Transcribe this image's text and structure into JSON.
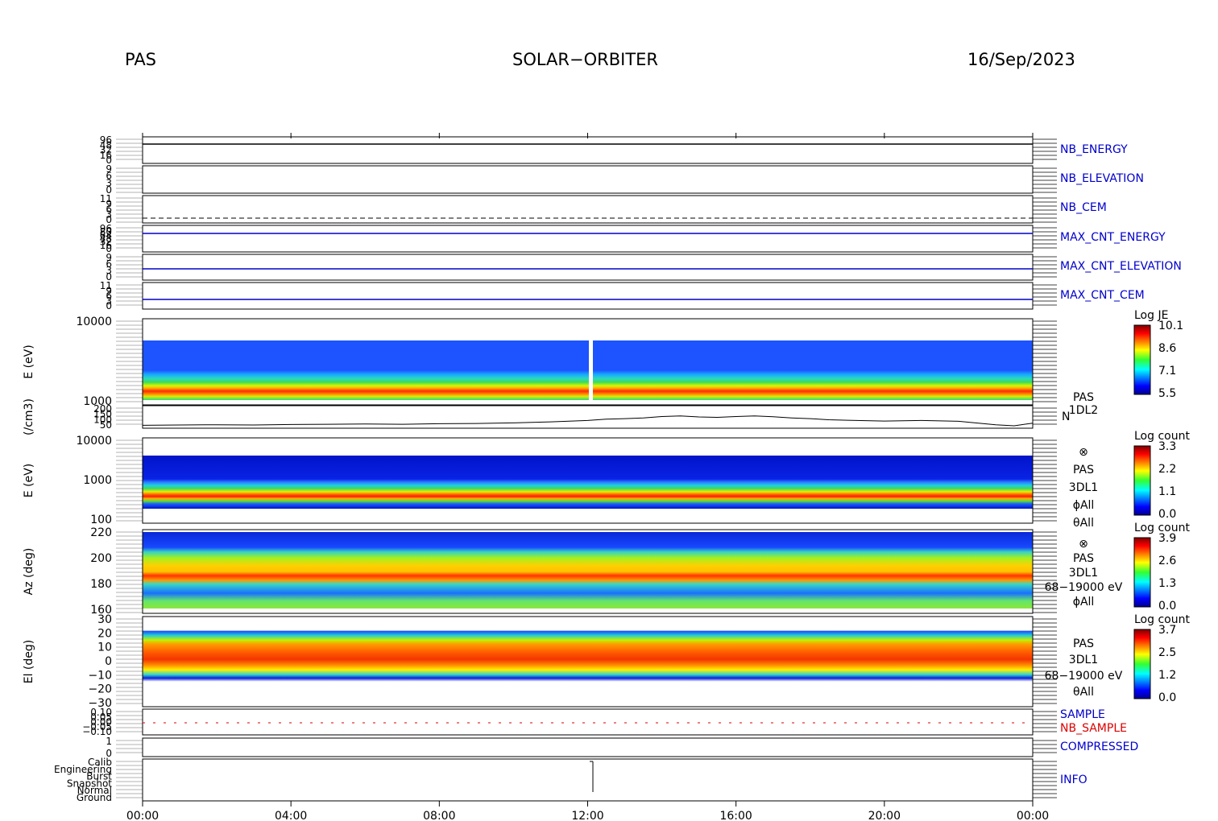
{
  "header": {
    "instrument": "PAS",
    "mission": "SOLAR−ORBITER",
    "date": "16/Sep/2023"
  },
  "colors": {
    "line_blue": "#0000cc",
    "red": "#dd0000",
    "frame": "#000000"
  },
  "chart_data": {
    "type": "heatmap",
    "x_ticks": [
      "00:00",
      "04:00",
      "08:00",
      "12:00",
      "16:00",
      "20:00",
      "00:00"
    ],
    "panels": [
      {
        "id": "nb_energy",
        "label": "NB_ENERGY",
        "label_color": "#0000cc",
        "y_ticks": [
          "96",
          "48",
          "32",
          "16",
          "0"
        ]
      },
      {
        "id": "nb_elevation",
        "label": "NB_ELEVATION",
        "label_color": "#0000cc",
        "y_ticks": [
          "9",
          "6",
          "3",
          "0"
        ]
      },
      {
        "id": "nb_cem",
        "label": "NB_CEM",
        "label_color": "#0000cc",
        "y_ticks": [
          "11",
          "9",
          "6",
          "3",
          "0"
        ]
      },
      {
        "id": "max_cnt_energy",
        "label": "MAX_CNT_ENERGY",
        "label_color": "#0000cc",
        "y_ticks": [
          "96",
          "80",
          "64",
          "48",
          "32",
          "16",
          "0"
        ]
      },
      {
        "id": "max_cnt_elevation",
        "label": "MAX_CNT_ELEVATION",
        "label_color": "#0000cc",
        "y_ticks": [
          "9",
          "6",
          "3",
          "0"
        ]
      },
      {
        "id": "max_cnt_cem",
        "label": "MAX_CNT_CEM",
        "label_color": "#0000cc",
        "y_ticks": [
          "11",
          "9",
          "6",
          "3",
          "0"
        ]
      },
      {
        "id": "energy_1d",
        "ylabel": "E (eV)",
        "y_ticks": [
          "10000",
          "1000"
        ],
        "side_labels": [
          "PAS",
          "1DL2"
        ],
        "colorbar_title": "Log JE",
        "colorbar_ticks": [
          "10.1",
          "8.6",
          "7.1",
          "5.5"
        ]
      },
      {
        "id": "density",
        "ylabel": "(/cm3)",
        "y_ticks": [
          "200",
          "150",
          "100",
          "50"
        ],
        "side_labels": [
          "N"
        ]
      },
      {
        "id": "energy_3d",
        "ylabel": "E (eV)",
        "y_ticks": [
          "10000",
          "1000",
          "100"
        ],
        "side_labels": [
          "⊗",
          "PAS",
          "3DL1",
          "ϕAll",
          "θAll"
        ],
        "colorbar_title": "Log count",
        "colorbar_ticks": [
          "3.3",
          "2.2",
          "1.1",
          "0.0"
        ]
      },
      {
        "id": "azimuth",
        "ylabel": "Az (deg)",
        "y_ticks": [
          "220",
          "200",
          "180",
          "160"
        ],
        "side_labels": [
          "⊗",
          "PAS",
          "3DL1",
          "68−19000 eV",
          "ϕAll"
        ],
        "colorbar_title": "Log count",
        "colorbar_ticks": [
          "3.9",
          "2.6",
          "1.3",
          "0.0"
        ]
      },
      {
        "id": "elevation",
        "ylabel": "El (deg)",
        "y_ticks": [
          "30",
          "20",
          "10",
          "0",
          "−10",
          "−20",
          "−30"
        ],
        "side_labels": [
          "PAS",
          "3DL1",
          "68−19000 eV",
          "θAll"
        ],
        "colorbar_title": "Log count",
        "colorbar_ticks": [
          "3.7",
          "2.5",
          "1.2",
          "0.0"
        ]
      },
      {
        "id": "sample",
        "labels": [
          "SAMPLE",
          "NB_SAMPLE"
        ],
        "label_colors": [
          "#0000cc",
          "#dd0000"
        ],
        "y_ticks": [
          "0.10",
          "0.05",
          "0.00",
          "−0.05",
          "−0.10"
        ]
      },
      {
        "id": "compressed",
        "label": "COMPRESSED",
        "label_color": "#0000cc",
        "y_ticks": [
          "1",
          "0"
        ]
      },
      {
        "id": "info",
        "label": "INFO",
        "label_color": "#0000cc",
        "y_ticks": [
          "Calib",
          "Engineering",
          "Burst",
          "Snapshot",
          "Normal",
          "Ground"
        ]
      }
    ],
    "series": [
      {
        "panel": "density",
        "name": "N",
        "x_hours": [
          0,
          1,
          2,
          3,
          4,
          5,
          6,
          7,
          8,
          9,
          10,
          11,
          12,
          12.5,
          13,
          13.5,
          14,
          14.5,
          15,
          15.5,
          16,
          16.5,
          17,
          17.5,
          18,
          18.5,
          19,
          20,
          21,
          22,
          23,
          23.5,
          24
        ],
        "values": [
          62,
          64,
          66,
          64,
          68,
          70,
          72,
          70,
          74,
          76,
          80,
          88,
          98,
          108,
          112,
          118,
          128,
          132,
          125,
          122,
          128,
          132,
          126,
          118,
          112,
          104,
          100,
          94,
          98,
          92,
          66,
          58,
          78
        ]
      }
    ]
  }
}
